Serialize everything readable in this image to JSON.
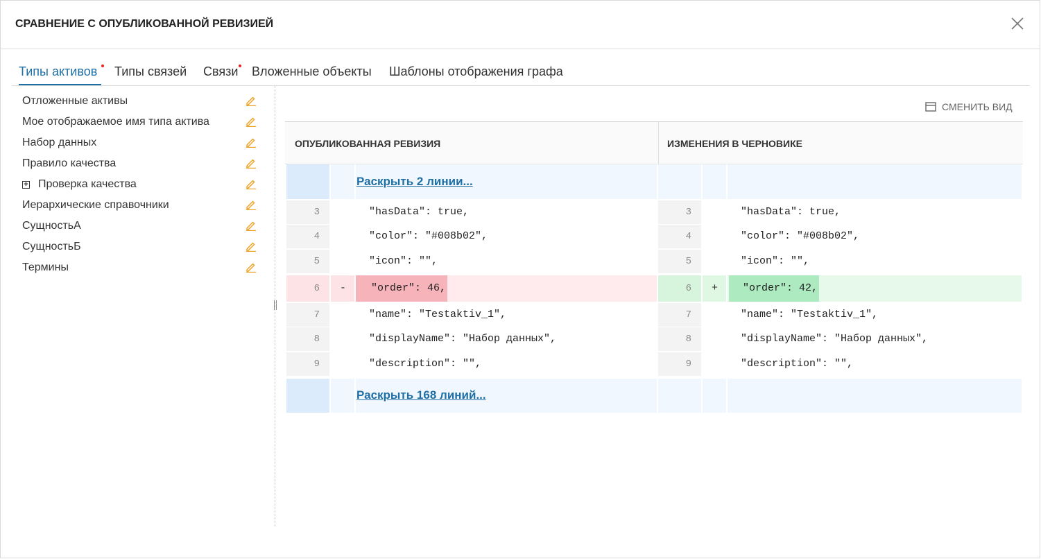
{
  "dialog": {
    "title": "СРАВНЕНИЕ С ОПУБЛИКОВАННОЙ РЕВИЗИЕЙ"
  },
  "tabs": [
    {
      "label": "Типы активов",
      "active": true,
      "has_changes": true
    },
    {
      "label": "Типы связей",
      "active": false,
      "has_changes": false
    },
    {
      "label": "Связи",
      "active": false,
      "has_changes": true
    },
    {
      "label": "Вложенные объекты",
      "active": false,
      "has_changes": false
    },
    {
      "label": "Шаблоны отображения графа",
      "active": false,
      "has_changes": false
    }
  ],
  "sidebar": {
    "items": [
      {
        "label": "Отложенные активы"
      },
      {
        "label": "Мое отображаемое имя типа актива"
      },
      {
        "label": "Набор данных"
      },
      {
        "label": "Правило качества"
      },
      {
        "label": "Проверка качества",
        "expandable": true
      },
      {
        "label": "Иерархические справочники"
      },
      {
        "label": "СущностьА"
      },
      {
        "label": "СущностьБ"
      },
      {
        "label": "Термины"
      }
    ]
  },
  "toolbar": {
    "switch_view_label": "СМЕНИТЬ ВИД"
  },
  "diff": {
    "left_header": "ОПУБЛИКОВАННАЯ РЕВИЗИЯ",
    "right_header": "ИЗМЕНЕНИЯ В ЧЕРНОВИКЕ",
    "expand_top": "Раскрыть 2 линии...",
    "expand_bottom": "Раскрыть 168 линий...",
    "rows": [
      {
        "ln": "3",
        "left": "\"hasData\": true,",
        "right": "\"hasData\": true,",
        "type": "same"
      },
      {
        "ln": "4",
        "left": "\"color\": \"#008b02\",",
        "right": "\"color\": \"#008b02\",",
        "type": "same"
      },
      {
        "ln": "5",
        "left": "\"icon\": \"\",",
        "right": "\"icon\": \"\",",
        "type": "same"
      },
      {
        "ln": "6",
        "left": "\"order\": 46,",
        "right": "\"order\": 42,",
        "type": "changed",
        "left_sign": "-",
        "right_sign": "+"
      },
      {
        "ln": "7",
        "left": "\"name\": \"Testaktiv_1\",",
        "right": "\"name\": \"Testaktiv_1\",",
        "type": "same"
      },
      {
        "ln": "8",
        "left": "\"displayName\": \"Набор данных\",",
        "right": "\"displayName\": \"Набор данных\",",
        "type": "same"
      },
      {
        "ln": "9",
        "left": "\"description\": \"\",",
        "right": "\"description\": \"\",",
        "type": "same"
      }
    ]
  },
  "colors": {
    "accent": "#1f6fa4",
    "pencil": "#f0a020",
    "badge": "#e22222",
    "removed_row": "#ffebee",
    "removed_token": "#f7b3ba",
    "added_row": "#e6f9ea",
    "added_token": "#aeeac0",
    "expand_row": "#f0f7ff",
    "expand_gutter": "#dcebfb"
  }
}
